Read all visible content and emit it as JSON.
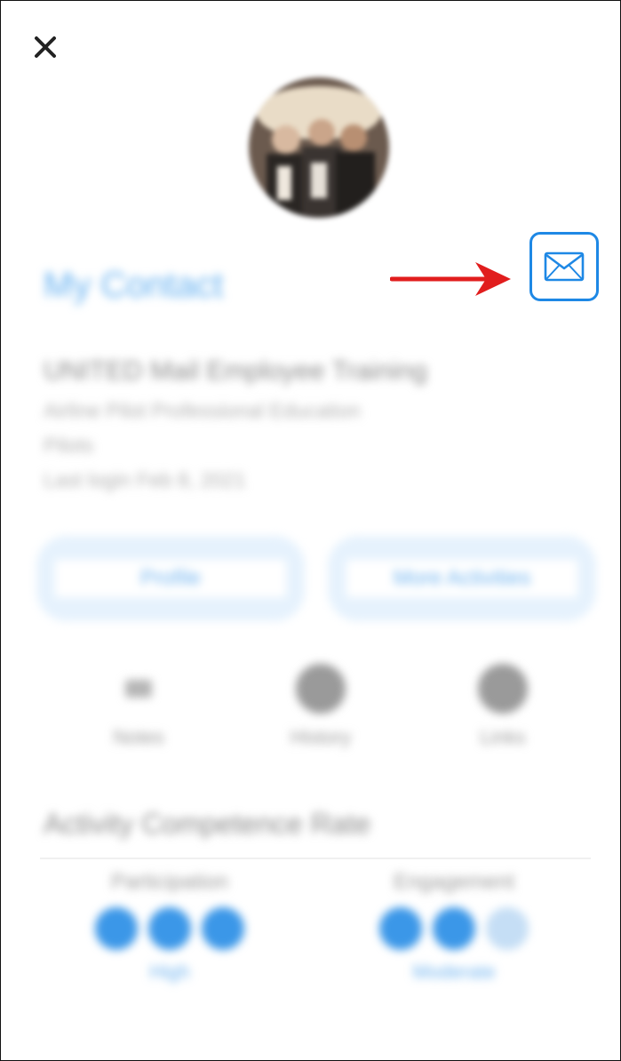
{
  "header": {
    "close_icon": "close-icon"
  },
  "profile": {
    "avatar_icon": "profile-photo",
    "name": "My Contact",
    "email_icon": "envelope-icon",
    "annotation_color": "#e11d1d",
    "accent_color": "#1e88e5"
  },
  "details": {
    "title": "UNITED Mail Employee Training",
    "line1": "Airline Pilot Professional Education",
    "line2": "Pilots",
    "line3": "Last login Feb 8, 2021"
  },
  "actions": {
    "primary_label": "Profile",
    "secondary_label": "More Activities"
  },
  "quick_actions": [
    {
      "label": "Notes",
      "icon": "notes-icon"
    },
    {
      "label": "History",
      "icon": "history-icon"
    },
    {
      "label": "Links",
      "icon": "links-icon"
    }
  ],
  "activity": {
    "heading": "Activity Competence Rate",
    "ratings": [
      {
        "label": "Participation",
        "value": "High",
        "stars": 3,
        "max": 3
      },
      {
        "label": "Engagement",
        "value": "Moderate",
        "stars": 2,
        "max": 3
      }
    ]
  }
}
